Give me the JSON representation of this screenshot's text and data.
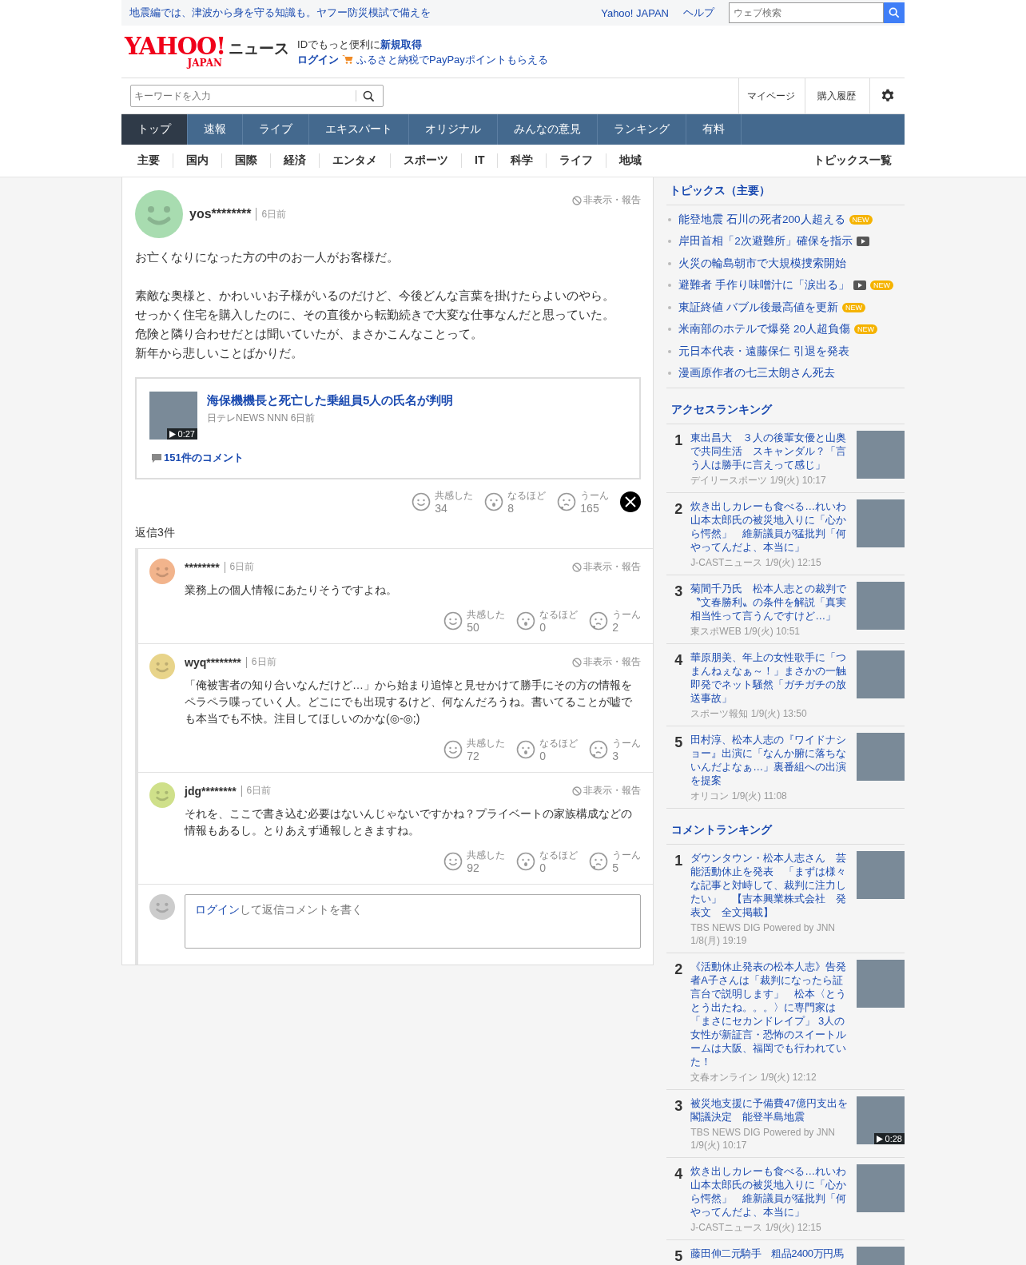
{
  "top_bar": {
    "notice": "地震編では、津波から身を守る知識も。ヤフー防災模試で備えを",
    "links": [
      "Yahoo! JAPAN",
      "ヘルプ"
    ],
    "search": {
      "placeholder": "ウェブ検索"
    }
  },
  "header": {
    "logo_main": "YAHOO!",
    "logo_sub": "JAPAN",
    "service": "ニュース",
    "promo_text": "IDでもっと便利に",
    "promo_link": "新規取得",
    "login": "ログイン",
    "furusato": "ふるさと納税でPayPayポイントもらえる"
  },
  "search_row": {
    "placeholder": "キーワードを入力",
    "links": [
      "マイページ",
      "購入履歴"
    ]
  },
  "nav_tabs": [
    {
      "label": "トップ",
      "selected": true
    },
    {
      "label": "速報",
      "selected": false
    },
    {
      "label": "ライブ",
      "selected": false
    },
    {
      "label": "エキスパート",
      "selected": false
    },
    {
      "label": "オリジナル",
      "selected": false
    },
    {
      "label": "みんなの意見",
      "selected": false
    },
    {
      "label": "ランキング",
      "selected": false
    },
    {
      "label": "有料",
      "selected": false
    }
  ],
  "sub_nav": [
    "主要",
    "国内",
    "国際",
    "経済",
    "エンタメ",
    "スポーツ",
    "IT",
    "科学",
    "ライフ",
    "地域"
  ],
  "sub_nav_right": "トピックス一覧",
  "comment": {
    "user": "yos********",
    "time": "6日前",
    "hide_report": "非表示・報告",
    "paragraphs": [
      [
        "お亡くなりになった方の中のお一人がお客様だ。"
      ],
      [
        "素敵な奥様と、かわいいお子様がいるのだけど、今後どんな言葉を掛けたらよいのやら。",
        "せっかく住宅を購入したのに、その直後から転勤続きで大変な仕事なんだと思っていた。",
        "危険と隣り合わせだとは聞いていたが、まさかこんなことって。",
        "新年から悲しいことばかりだ。"
      ]
    ],
    "article": {
      "title": "海保機機長と死亡した乗組員5人の氏名が判明",
      "source": "日テレNEWS NNN 6日前",
      "duration": "0:27",
      "comments": "151件のコメント"
    },
    "reactions": [
      {
        "kind": "empathy",
        "label": "共感した",
        "count": "34"
      },
      {
        "kind": "insight",
        "label": "なるほど",
        "count": "8"
      },
      {
        "kind": "doubt",
        "label": "うーん",
        "count": "165"
      }
    ]
  },
  "replies_label": "返信3件",
  "replies": [
    {
      "user": "********",
      "time": "6日前",
      "hide_report": "非表示・報告",
      "color": "#f2b48c",
      "text": "業務上の個人情報にあたりそうですよね。",
      "reactions": [
        {
          "kind": "empathy",
          "label": "共感した",
          "count": "50"
        },
        {
          "kind": "insight",
          "label": "なるほど",
          "count": "0"
        },
        {
          "kind": "doubt",
          "label": "うーん",
          "count": "2"
        }
      ]
    },
    {
      "user": "wyq********",
      "time": "6日前",
      "hide_report": "非表示・報告",
      "color": "#e8d48a",
      "text": "「俺被害者の知り合いなんだけど…」から始まり追悼と見せかけて勝手にその方の情報をペラペラ喋っていく人。どこにでも出現するけど、何なんだろうね。書いてることが嘘でも本当でも不快。注目してほしいのかな(◎-◎;)",
      "reactions": [
        {
          "kind": "empathy",
          "label": "共感した",
          "count": "72"
        },
        {
          "kind": "insight",
          "label": "なるほど",
          "count": "0"
        },
        {
          "kind": "doubt",
          "label": "うーん",
          "count": "3"
        }
      ]
    },
    {
      "user": "jdg********",
      "time": "6日前",
      "hide_report": "非表示・報告",
      "color": "#cfe08a",
      "text": "それを、ここで書き込む必要はないんじゃないですかね？プライベートの家族構成などの情報もあるし。とりあえず通報しときますね。",
      "reactions": [
        {
          "kind": "empathy",
          "label": "共感した",
          "count": "92"
        },
        {
          "kind": "insight",
          "label": "なるほど",
          "count": "0"
        },
        {
          "kind": "doubt",
          "label": "うーん",
          "count": "5"
        }
      ]
    }
  ],
  "reply_box": {
    "login": "ログイン",
    "placeholder": "して返信コメントを書く"
  },
  "topics": {
    "title": "トピックス（主要）",
    "items": [
      {
        "text": "能登地震 石川の死者200人超える",
        "video": false,
        "badge": "NEW"
      },
      {
        "text": "岸田首相「2次避難所」確保を指示",
        "video": true
      },
      {
        "text": "火災の輪島朝市で大規模捜索開始",
        "video": false
      },
      {
        "text": "避難者 手作り味噌汁に「涙出る」",
        "video": true,
        "badge": "NEW"
      },
      {
        "text": "東証終値 バブル後最高値を更新",
        "video": false,
        "badge": "NEW"
      },
      {
        "text": "米南部のホテルで爆発 20人超負傷",
        "video": false,
        "badge": "NEW"
      },
      {
        "text": "元日本代表・遠藤保仁 引退を発表",
        "video": false
      },
      {
        "text": "漫画原作者の七三太朗さん死去",
        "video": false
      }
    ]
  },
  "access_ranking": {
    "title": "アクセスランキング",
    "items": [
      {
        "rank": "1",
        "title": "東出昌大　３人の後輩女優と山奥で共同生活　スキャンダル？「言う人は勝手に言えって感じ」",
        "meta": "デイリースポーツ 1/9(火) 10:17"
      },
      {
        "rank": "2",
        "title": "炊き出しカレーも食べる…れいわ山本太郎氏の被災地入りに「心から愕然」　維新議員が猛批判「何やってんだよ、本当に」",
        "meta": "J-CASTニュース 1/9(火) 12:15"
      },
      {
        "rank": "3",
        "title": "菊間千乃氏　松本人志との裁判で〝文春勝利〟の条件を解説「真実相当性って言うんですけど…」",
        "meta": "東スポWEB 1/9(火) 10:51"
      },
      {
        "rank": "4",
        "title": "華原朋美、年上の女性歌手に「つまんねぇなぁ～！」まさかの一触即発でネット騒然「ガチガチの放送事故」",
        "meta": "スポーツ報知 1/9(火) 13:50"
      },
      {
        "rank": "5",
        "title": "田村淳、松本人志の『ワイドナショー』出演に「なんか腑に落ちないんだよなぁ…」裏番組への出演を提案",
        "meta": "オリコン 1/9(火) 11:08"
      }
    ]
  },
  "comment_ranking": {
    "title": "コメントランキング",
    "items": [
      {
        "rank": "1",
        "title": "ダウンタウン・松本人志さん　芸能活動休止を発表　「まずは様々な記事と対峙して、裁判に注力したい」　【吉本興業株式会社　発表文　全文掲載】",
        "meta": "TBS NEWS DIG Powered by JNN 1/8(月) 19:19"
      },
      {
        "rank": "2",
        "title": "《活動休止発表の松本人志》告発者A子さんは「裁判になったら証言台で説明します」　松本〈とうとう出たね。。。〉に専門家は「まさにセカンドレイプ」 3人の女性が新証言・恐怖のスイートルームは大阪、福岡でも行われていた！",
        "meta": "文春オンライン 1/9(火) 12:12"
      },
      {
        "rank": "3",
        "title": "被災地支援に予備費47億円支出を閣議決定　能登半島地震",
        "meta": "TBS NEWS DIG Powered by JNN 1/9(火) 10:17",
        "duration": "0:28"
      },
      {
        "rank": "4",
        "title": "炊き出しカレーも食べる…れいわ山本太郎氏の被災地入りに「心から愕然」　維新議員が猛批判「何やってんだよ、本当に」",
        "meta": "J-CASTニュース 1/9(火) 12:15"
      },
      {
        "rank": "5",
        "title": "藤田伸二元騎手　粗品2400万円馬"
      }
    ]
  }
}
